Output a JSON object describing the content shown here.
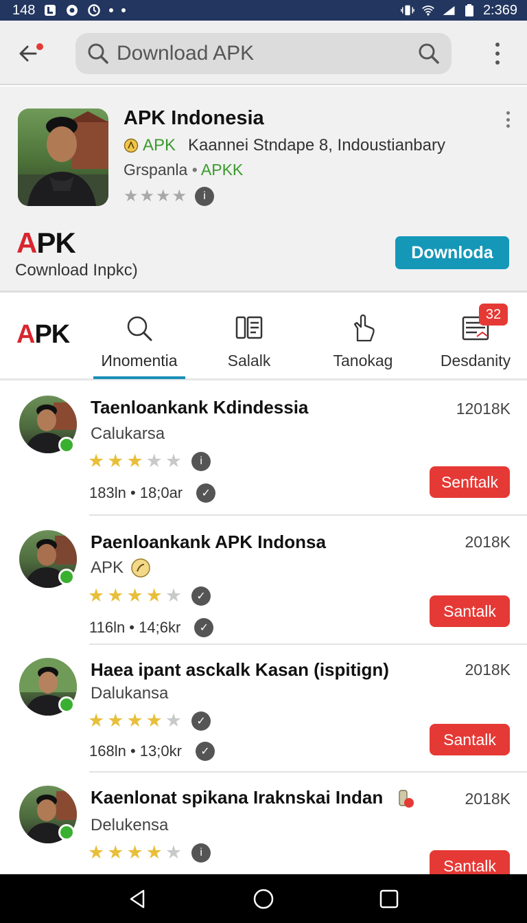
{
  "status_bar": {
    "time_left": "148",
    "time_right": "2:369"
  },
  "search": {
    "placeholder": "Download APK"
  },
  "featured": {
    "title": "APK Indonesia",
    "tag": "APK",
    "publisher": "Kaannei Stndape 8, Indoustianbary",
    "category": "Grspanla",
    "category_tag": "APKK",
    "brand_a": "A",
    "brand_rest": "PK",
    "subtitle": "Cownload Inpkс)",
    "download_label": "Downloda"
  },
  "tabs": {
    "logo_a": "A",
    "logo_rest": "PK",
    "items": [
      {
        "label": "Иnomentia",
        "icon": "search-icon"
      },
      {
        "label": "Salalk",
        "icon": "list-icon"
      },
      {
        "label": "Tanokag",
        "icon": "hand-icon"
      },
      {
        "label": "Desdanity",
        "icon": "document-icon",
        "badge": "32"
      }
    ]
  },
  "apps": [
    {
      "title": "Taenloankank Kdindessia",
      "subtitle": "Calukarsa",
      "size": "12018K",
      "rating": 3,
      "meta": "183ln • 18;0ar",
      "action": "Senftalk"
    },
    {
      "title": "Paenloankank APK Indonsa",
      "subtitle": "APK",
      "size": "2018K",
      "rating": 4,
      "meta": "116ln • 14;6kr",
      "action": "Santalk"
    },
    {
      "title": "Haea ipant asckalk Kasan (ispitign)",
      "subtitle": "Dalukansa",
      "size": "2018K",
      "rating": 4,
      "meta": "168ln • 13;0kr",
      "action": "Santalk"
    },
    {
      "title": "Kaenlonat spikana Iraknskai Indan",
      "subtitle": "Delukensa",
      "size": "2018K",
      "rating": 4,
      "meta": "",
      "action": "Santalk"
    }
  ],
  "colors": {
    "status_bar": "#22365f",
    "accent_blue": "#1597b8",
    "brand_red": "#d8262e",
    "action_red": "#e53935",
    "star": "#e8bf3a",
    "online": "#3ab030"
  }
}
